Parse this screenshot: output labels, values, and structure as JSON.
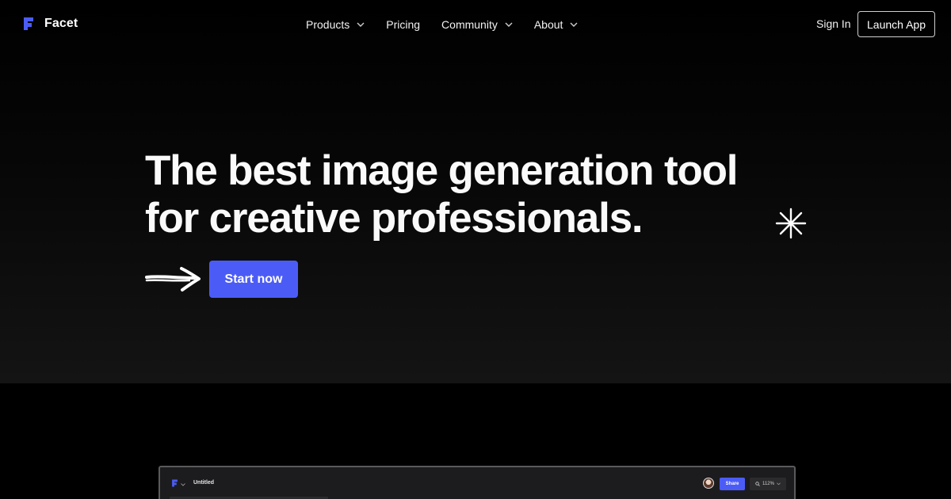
{
  "brand": {
    "name": "Facet",
    "accent": "#4b5cf6"
  },
  "nav": {
    "items": [
      {
        "label": "Products",
        "has_dropdown": true
      },
      {
        "label": "Pricing",
        "has_dropdown": false
      },
      {
        "label": "Community",
        "has_dropdown": true
      },
      {
        "label": "About",
        "has_dropdown": true
      }
    ],
    "sign_in": "Sign In",
    "launch_app": "Launch App"
  },
  "hero": {
    "headline_line1": "The best image generation tool",
    "headline_line2": "for creative professionals.",
    "cta": "Start now"
  },
  "preview": {
    "title": "Untitled",
    "share_label": "Share",
    "zoom_label": "112%"
  }
}
